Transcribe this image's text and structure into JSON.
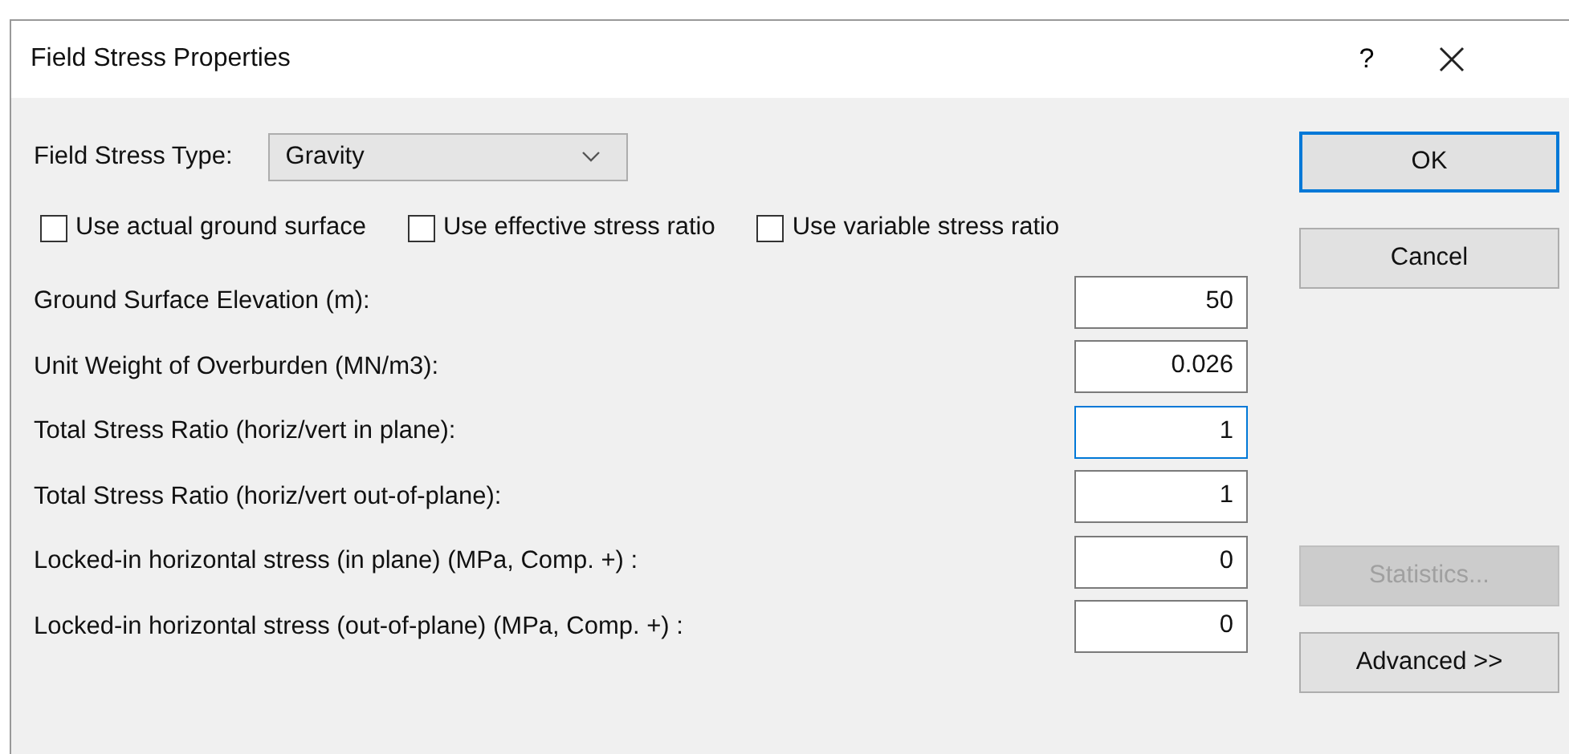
{
  "window": {
    "title": "Field Stress Properties",
    "help": "?"
  },
  "stress_type": {
    "label": "Field Stress Type:",
    "value": "Gravity"
  },
  "checkboxes": [
    {
      "label": "Use actual ground surface",
      "checked": false
    },
    {
      "label": "Use effective stress ratio",
      "checked": false
    },
    {
      "label": "Use variable stress ratio",
      "checked": false
    }
  ],
  "fields": [
    {
      "label": "Ground Surface Elevation (m):",
      "value": "50",
      "focused": false
    },
    {
      "label": "Unit Weight of Overburden (MN/m3):",
      "value": "0.026",
      "focused": false
    },
    {
      "label": "Total Stress Ratio (horiz/vert in plane):",
      "value": "1",
      "focused": true
    },
    {
      "label": "Total Stress Ratio (horiz/vert out-of-plane):",
      "value": "1",
      "focused": false
    },
    {
      "label": "Locked-in horizontal stress (in plane) (MPa, Comp. +) :",
      "value": "0",
      "focused": false
    },
    {
      "label": "Locked-in horizontal stress (out-of-plane) (MPa, Comp. +) :",
      "value": "0",
      "focused": false
    }
  ],
  "buttons": [
    {
      "label": "OK",
      "default": true,
      "disabled": false
    },
    {
      "label": "Cancel",
      "default": false,
      "disabled": false
    },
    {
      "label": "Statistics...",
      "default": false,
      "disabled": true
    },
    {
      "label": "Advanced >>",
      "default": false,
      "disabled": false
    }
  ]
}
